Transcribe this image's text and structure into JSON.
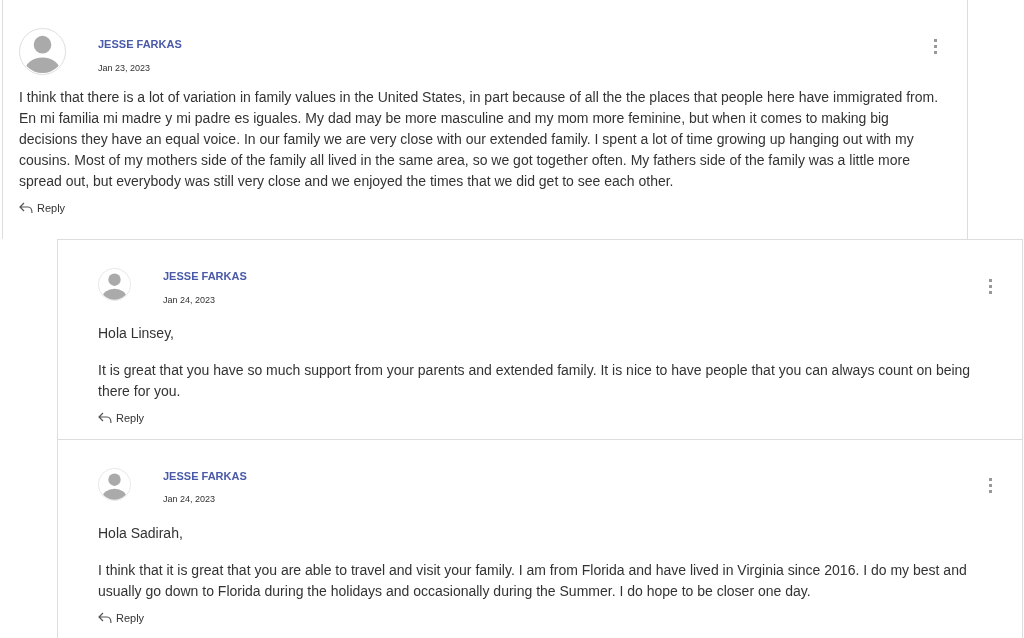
{
  "comment": {
    "author": "JESSE FARKAS",
    "date": "Jan 23, 2023",
    "paragraphs": [
      "I think that there is a lot of variation in family values in the United States, in part because of all the the places that people here have immigrated from. En mi familia mi madre y mi padre es iguales. My dad may be more masculine and my mom more feminine, but when it comes to making big decisions they have an equal voice. In our family we are very close with our extended family. I spent a lot of time growing up hanging out with my cousins. Most of my mothers side of the family all lived in the same area, so we got together often. My fathers side of the family was a little more spread out, but everybody was still very close and we enjoyed the times that we did get to see each other."
    ],
    "reply_label": "Reply"
  },
  "replies": [
    {
      "author": "JESSE FARKAS",
      "date": "Jan 24, 2023",
      "paragraphs": [
        "Hola Linsey,",
        "It is great that you have so much support from your parents and extended family. It is nice to have people that you can always count on being there for you."
      ],
      "reply_label": "Reply"
    },
    {
      "author": "JESSE FARKAS",
      "date": "Jan 24, 2023",
      "paragraphs": [
        "Hola Sadirah,",
        "I think that it is great that you are able to travel and visit your family. I am from Florida and have lived in Virginia since 2016. I do my best and usually go down to Florida during the holidays and occasionally during the Summer. I do hope to be closer one day."
      ],
      "reply_label": "Reply"
    }
  ]
}
